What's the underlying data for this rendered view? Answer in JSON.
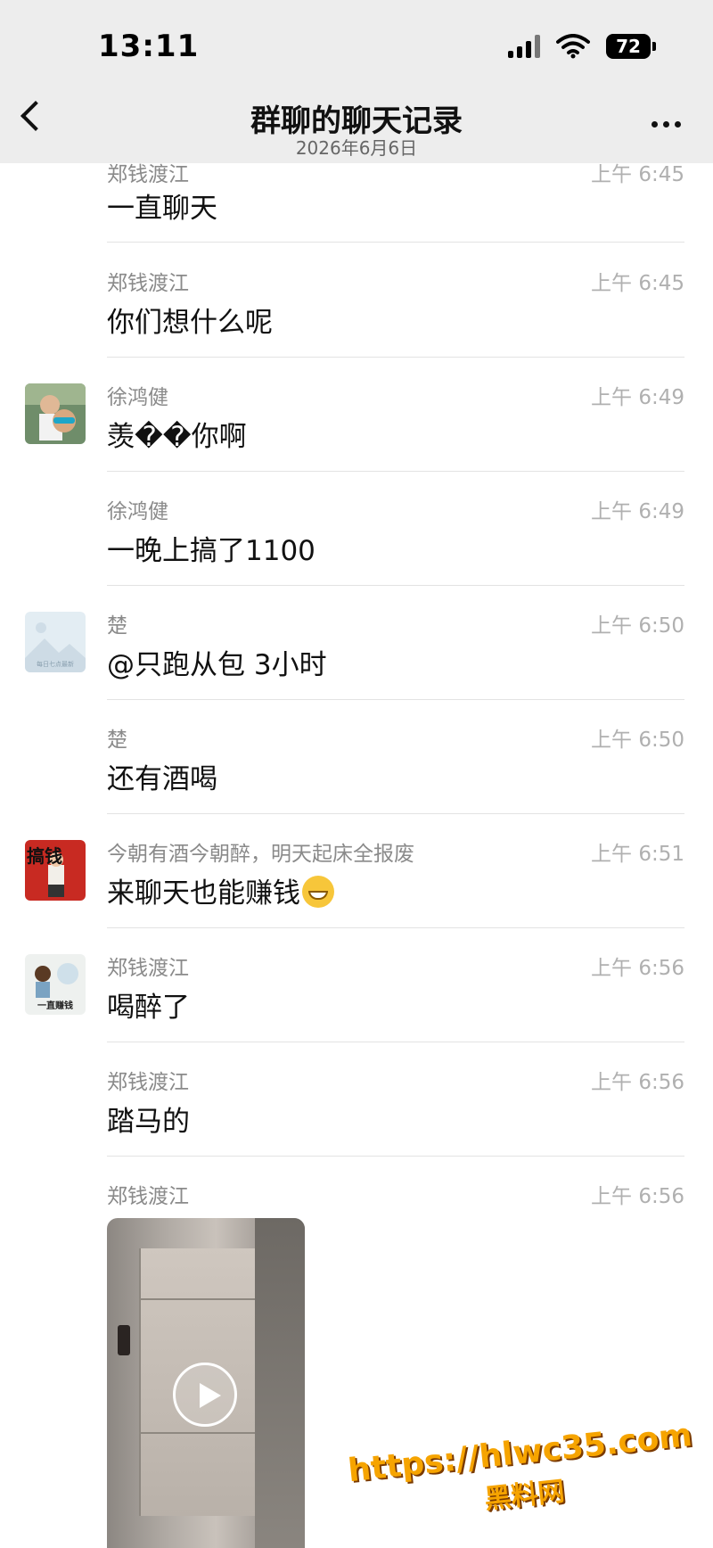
{
  "status_bar": {
    "time": "13:11",
    "battery": "72"
  },
  "nav": {
    "title": "群聊的聊天记录",
    "date": "2026年6月6日"
  },
  "messages": [
    {
      "sender": "郑钱渡江",
      "time": "上午 6:45",
      "text": "一直聊天"
    },
    {
      "sender": "郑钱渡江",
      "time": "上午 6:45",
      "text": "你们想什么呢"
    },
    {
      "sender": "徐鸿健",
      "time": "上午 6:49",
      "text": "羡��你啊"
    },
    {
      "sender": "徐鸿健",
      "time": "上午 6:49",
      "text": "一晚上搞了1100"
    },
    {
      "sender": "楚",
      "time": "上午 6:50",
      "text": "@只跑从包 3小时"
    },
    {
      "sender": "楚",
      "time": "上午 6:50",
      "text": "还有酒喝"
    },
    {
      "sender": "今朝有酒今朝醉，明天起床全报废",
      "time": "上午 6:51",
      "text": "来聊天也能赚钱"
    },
    {
      "sender": "郑钱渡江",
      "time": "上午 6:56",
      "text": "喝醉了"
    },
    {
      "sender": "郑钱渡江",
      "time": "上午 6:56",
      "text": "踏马的"
    },
    {
      "sender": "郑钱渡江",
      "time": "上午 6:56",
      "text": ""
    }
  ],
  "avatar_labels": {
    "chu_caption": "每日七点最新",
    "red_text": "搞钱",
    "zheng_caption": "一直赚钱"
  },
  "watermark": {
    "url": "https://hlwc35.com",
    "name": "黑料网"
  }
}
